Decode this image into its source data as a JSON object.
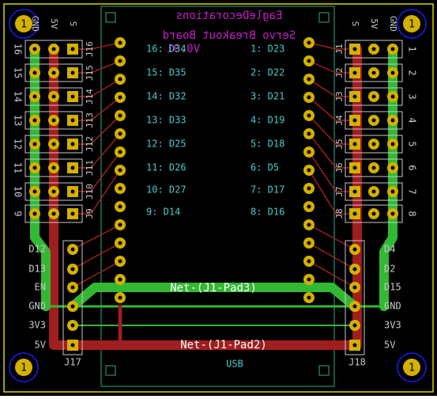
{
  "title": {
    "line1": "EagleDecorations",
    "line2": "Servo Breakout Board",
    "version": "V0.91"
  },
  "mount_hole_label": "1",
  "col_headers": {
    "left": [
      "GND",
      "5V",
      "S"
    ],
    "right": [
      "S",
      "5V",
      "GND"
    ]
  },
  "left_rows": [
    "16",
    "15",
    "14",
    "13",
    "12",
    "11",
    "10",
    "9"
  ],
  "right_rows": [
    "1",
    "2",
    "3",
    "4",
    "5",
    "6",
    "7",
    "8"
  ],
  "left_refs": [
    "J16",
    "J15",
    "J14",
    "J13",
    "J12",
    "J11",
    "J10",
    "J9"
  ],
  "right_refs": [
    "J1",
    "J2",
    "J3",
    "J4",
    "J5",
    "J6",
    "J7",
    "J8"
  ],
  "pin_map_left": [
    "16: D34",
    "15: D35",
    "14: D32",
    "13: D33",
    "12: D25",
    "11: D26",
    "10: D27",
    "9: D14"
  ],
  "pin_map_right": [
    "1: D23",
    "2: D22",
    "3: D21",
    "4: D19",
    "5: D18",
    "6: D5",
    "7: D17",
    "8: D16"
  ],
  "left_power_labels": [
    "D12",
    "D13",
    "EN",
    "GND",
    "3V3",
    "5V"
  ],
  "right_power_labels": [
    "D4",
    "D2",
    "D15",
    "GND",
    "3V3",
    "5V"
  ],
  "left_connector": "J17",
  "right_connector": "J18",
  "usb_label": "USB",
  "net_labels": {
    "green": "Net-(J1-Pad3)",
    "red": "Net-(J1-Pad2)"
  },
  "colors": {
    "background": "#000000",
    "outline": "#d4d400",
    "copper_green": "#33b833",
    "copper_red": "#a01e1e",
    "pad": "#d4b000",
    "silk": "#c9c9c9",
    "cyan_text": "#4ec9c9",
    "magenta_text": "#c81ec8",
    "hole_ring": "#1a1aff"
  }
}
